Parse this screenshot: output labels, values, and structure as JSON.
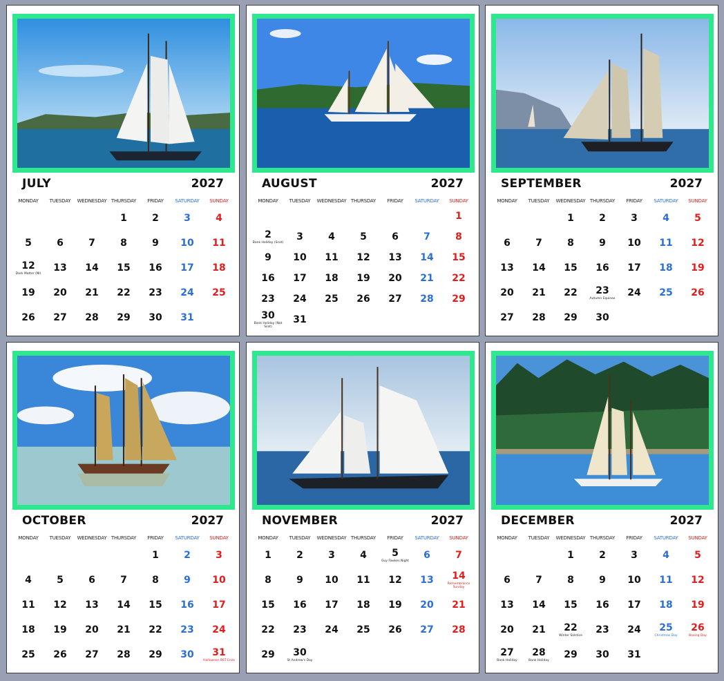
{
  "year": "2027",
  "weekday_headers": [
    "MONDAY",
    "TUESDAY",
    "WEDNESDAY",
    "THURSDAY",
    "FRIDAY",
    "SATURDAY",
    "SUNDAY"
  ],
  "colors": {
    "frame": "#2ee88e",
    "saturday": "#2b6fd6",
    "sunday": "#e31c1c",
    "background": "#9aa0b4"
  },
  "months": [
    {
      "name": "JULY",
      "photo": "sailing-ship-photo",
      "weeks": [
        [
          {
            "d": ""
          },
          {
            "d": ""
          },
          {
            "d": ""
          },
          {
            "d": "1"
          },
          {
            "d": "2"
          },
          {
            "d": "3"
          },
          {
            "d": "4"
          }
        ],
        [
          {
            "d": "5"
          },
          {
            "d": "6"
          },
          {
            "d": "7"
          },
          {
            "d": "8"
          },
          {
            "d": "9"
          },
          {
            "d": "10"
          },
          {
            "d": "11"
          }
        ],
        [
          {
            "d": "12",
            "n": "Dark Matter (NI)"
          },
          {
            "d": "13"
          },
          {
            "d": "14"
          },
          {
            "d": "15"
          },
          {
            "d": "16"
          },
          {
            "d": "17"
          },
          {
            "d": "18"
          }
        ],
        [
          {
            "d": "19"
          },
          {
            "d": "20"
          },
          {
            "d": "21"
          },
          {
            "d": "22"
          },
          {
            "d": "23"
          },
          {
            "d": "24"
          },
          {
            "d": "25"
          }
        ],
        [
          {
            "d": "26"
          },
          {
            "d": "27"
          },
          {
            "d": "28"
          },
          {
            "d": "29"
          },
          {
            "d": "30"
          },
          {
            "d": "31"
          },
          {
            "d": ""
          }
        ]
      ]
    },
    {
      "name": "AUGUST",
      "photo": "sailing-ship-photo",
      "weeks": [
        [
          {
            "d": ""
          },
          {
            "d": ""
          },
          {
            "d": ""
          },
          {
            "d": ""
          },
          {
            "d": ""
          },
          {
            "d": ""
          },
          {
            "d": "1"
          }
        ],
        [
          {
            "d": "2",
            "n": "Bank Holiday (Scot)"
          },
          {
            "d": "3"
          },
          {
            "d": "4"
          },
          {
            "d": "5"
          },
          {
            "d": "6"
          },
          {
            "d": "7"
          },
          {
            "d": "8"
          }
        ],
        [
          {
            "d": "9"
          },
          {
            "d": "10"
          },
          {
            "d": "11"
          },
          {
            "d": "12"
          },
          {
            "d": "13"
          },
          {
            "d": "14"
          },
          {
            "d": "15"
          }
        ],
        [
          {
            "d": "16"
          },
          {
            "d": "17"
          },
          {
            "d": "18"
          },
          {
            "d": "19"
          },
          {
            "d": "20"
          },
          {
            "d": "21"
          },
          {
            "d": "22"
          }
        ],
        [
          {
            "d": "23"
          },
          {
            "d": "24"
          },
          {
            "d": "25"
          },
          {
            "d": "26"
          },
          {
            "d": "27"
          },
          {
            "d": "28"
          },
          {
            "d": "29"
          }
        ],
        [
          {
            "d": "30",
            "n": "Bank Holiday (Not Scot)"
          },
          {
            "d": "31"
          },
          {
            "d": ""
          },
          {
            "d": ""
          },
          {
            "d": ""
          },
          {
            "d": ""
          },
          {
            "d": ""
          }
        ]
      ]
    },
    {
      "name": "SEPTEMBER",
      "photo": "sailing-ship-photo",
      "weeks": [
        [
          {
            "d": ""
          },
          {
            "d": ""
          },
          {
            "d": "1"
          },
          {
            "d": "2"
          },
          {
            "d": "3"
          },
          {
            "d": "4"
          },
          {
            "d": "5"
          }
        ],
        [
          {
            "d": "6"
          },
          {
            "d": "7"
          },
          {
            "d": "8"
          },
          {
            "d": "9"
          },
          {
            "d": "10"
          },
          {
            "d": "11"
          },
          {
            "d": "12"
          }
        ],
        [
          {
            "d": "13"
          },
          {
            "d": "14"
          },
          {
            "d": "15"
          },
          {
            "d": "16"
          },
          {
            "d": "17"
          },
          {
            "d": "18"
          },
          {
            "d": "19"
          }
        ],
        [
          {
            "d": "20"
          },
          {
            "d": "21"
          },
          {
            "d": "22"
          },
          {
            "d": "23",
            "n": "Autumn Equinox"
          },
          {
            "d": "24"
          },
          {
            "d": "25"
          },
          {
            "d": "26"
          }
        ],
        [
          {
            "d": "27"
          },
          {
            "d": "28"
          },
          {
            "d": "29"
          },
          {
            "d": "30"
          },
          {
            "d": ""
          },
          {
            "d": ""
          },
          {
            "d": ""
          }
        ]
      ]
    },
    {
      "name": "OCTOBER",
      "photo": "sailing-ship-photo",
      "weeks": [
        [
          {
            "d": ""
          },
          {
            "d": ""
          },
          {
            "d": ""
          },
          {
            "d": ""
          },
          {
            "d": "1"
          },
          {
            "d": "2"
          },
          {
            "d": "3"
          }
        ],
        [
          {
            "d": "4"
          },
          {
            "d": "5"
          },
          {
            "d": "6"
          },
          {
            "d": "7"
          },
          {
            "d": "8"
          },
          {
            "d": "9"
          },
          {
            "d": "10"
          }
        ],
        [
          {
            "d": "11"
          },
          {
            "d": "12"
          },
          {
            "d": "13"
          },
          {
            "d": "14"
          },
          {
            "d": "15"
          },
          {
            "d": "16"
          },
          {
            "d": "17"
          }
        ],
        [
          {
            "d": "18"
          },
          {
            "d": "19"
          },
          {
            "d": "20"
          },
          {
            "d": "21"
          },
          {
            "d": "22"
          },
          {
            "d": "23"
          },
          {
            "d": "24"
          }
        ],
        [
          {
            "d": "25"
          },
          {
            "d": "26"
          },
          {
            "d": "27"
          },
          {
            "d": "28"
          },
          {
            "d": "29"
          },
          {
            "d": "30"
          },
          {
            "d": "31",
            "n": "Halloween BST Ends"
          }
        ]
      ]
    },
    {
      "name": "NOVEMBER",
      "photo": "sailing-ship-photo",
      "weeks": [
        [
          {
            "d": "1"
          },
          {
            "d": "2"
          },
          {
            "d": "3"
          },
          {
            "d": "4"
          },
          {
            "d": "5",
            "n": "Guy Fawkes Night"
          },
          {
            "d": "6"
          },
          {
            "d": "7"
          }
        ],
        [
          {
            "d": "8"
          },
          {
            "d": "9"
          },
          {
            "d": "10"
          },
          {
            "d": "11"
          },
          {
            "d": "12"
          },
          {
            "d": "13"
          },
          {
            "d": "14",
            "n": "Remembrance Sunday"
          }
        ],
        [
          {
            "d": "15"
          },
          {
            "d": "16"
          },
          {
            "d": "17"
          },
          {
            "d": "18"
          },
          {
            "d": "19"
          },
          {
            "d": "20"
          },
          {
            "d": "21"
          }
        ],
        [
          {
            "d": "22"
          },
          {
            "d": "23"
          },
          {
            "d": "24"
          },
          {
            "d": "25"
          },
          {
            "d": "26"
          },
          {
            "d": "27"
          },
          {
            "d": "28"
          }
        ],
        [
          {
            "d": "29"
          },
          {
            "d": "30",
            "n": "St Andrew's Day"
          },
          {
            "d": ""
          },
          {
            "d": ""
          },
          {
            "d": ""
          },
          {
            "d": ""
          },
          {
            "d": ""
          }
        ]
      ]
    },
    {
      "name": "DECEMBER",
      "photo": "sailing-ship-photo",
      "weeks": [
        [
          {
            "d": ""
          },
          {
            "d": ""
          },
          {
            "d": "1"
          },
          {
            "d": "2"
          },
          {
            "d": "3"
          },
          {
            "d": "4"
          },
          {
            "d": "5"
          }
        ],
        [
          {
            "d": "6"
          },
          {
            "d": "7"
          },
          {
            "d": "8"
          },
          {
            "d": "9"
          },
          {
            "d": "10"
          },
          {
            "d": "11"
          },
          {
            "d": "12"
          }
        ],
        [
          {
            "d": "13"
          },
          {
            "d": "14"
          },
          {
            "d": "15"
          },
          {
            "d": "16"
          },
          {
            "d": "17"
          },
          {
            "d": "18"
          },
          {
            "d": "19"
          }
        ],
        [
          {
            "d": "20"
          },
          {
            "d": "21"
          },
          {
            "d": "22",
            "n": "Winter Solstice"
          },
          {
            "d": "23"
          },
          {
            "d": "24"
          },
          {
            "d": "25",
            "n": "Christmas Day"
          },
          {
            "d": "26",
            "n": "Boxing Day"
          }
        ],
        [
          {
            "d": "27",
            "n": "Bank Holiday"
          },
          {
            "d": "28",
            "n": "Bank Holiday"
          },
          {
            "d": "29"
          },
          {
            "d": "30"
          },
          {
            "d": "31"
          },
          {
            "d": ""
          },
          {
            "d": ""
          }
        ]
      ]
    }
  ]
}
